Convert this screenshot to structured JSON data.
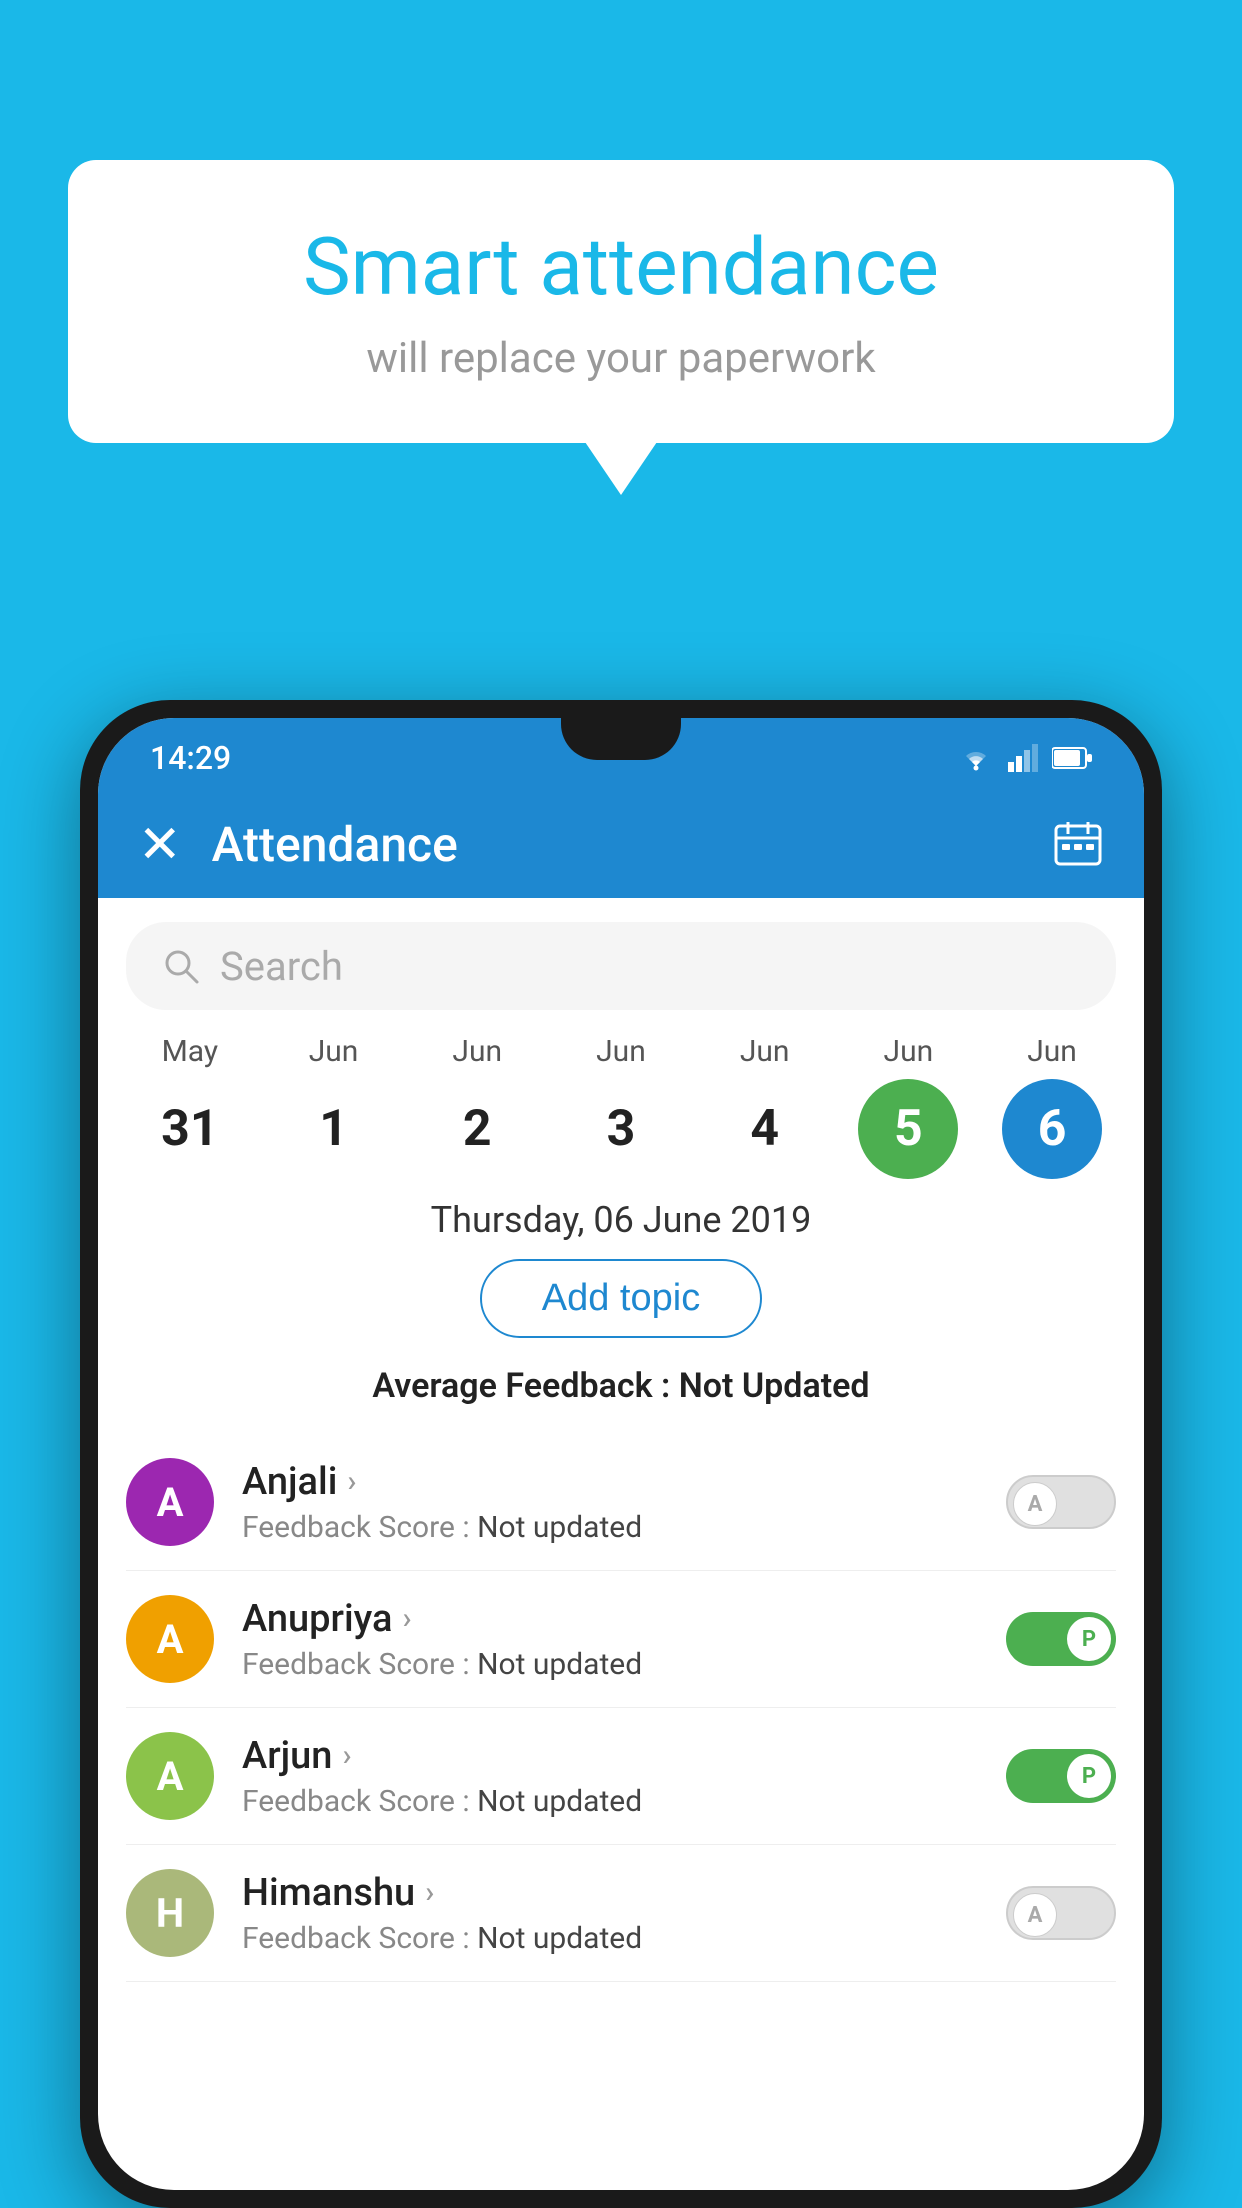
{
  "background_color": "#1ab8e8",
  "bubble": {
    "title": "Smart attendance",
    "subtitle": "will replace your paperwork"
  },
  "status_bar": {
    "time": "14:29"
  },
  "app_bar": {
    "title": "Attendance",
    "close_label": "×"
  },
  "search": {
    "placeholder": "Search"
  },
  "calendar": {
    "days": [
      {
        "month": "May",
        "date": "31",
        "state": "normal"
      },
      {
        "month": "Jun",
        "date": "1",
        "state": "normal"
      },
      {
        "month": "Jun",
        "date": "2",
        "state": "normal"
      },
      {
        "month": "Jun",
        "date": "3",
        "state": "normal"
      },
      {
        "month": "Jun",
        "date": "4",
        "state": "normal"
      },
      {
        "month": "Jun",
        "date": "5",
        "state": "today"
      },
      {
        "month": "Jun",
        "date": "6",
        "state": "selected"
      }
    ]
  },
  "selected_date": "Thursday, 06 June 2019",
  "add_topic_label": "Add topic",
  "avg_feedback_label": "Average Feedback :",
  "avg_feedback_value": "Not Updated",
  "students": [
    {
      "name": "Anjali",
      "avatar_letter": "A",
      "avatar_color": "#9c27b0",
      "feedback_label": "Feedback Score :",
      "feedback_value": "Not updated",
      "toggle": "off",
      "toggle_label": "A"
    },
    {
      "name": "Anupriya",
      "avatar_letter": "A",
      "avatar_color": "#f0a000",
      "feedback_label": "Feedback Score :",
      "feedback_value": "Not updated",
      "toggle": "on",
      "toggle_label": "P"
    },
    {
      "name": "Arjun",
      "avatar_letter": "A",
      "avatar_color": "#8bc34a",
      "feedback_label": "Feedback Score :",
      "feedback_value": "Not updated",
      "toggle": "on",
      "toggle_label": "P"
    },
    {
      "name": "Himanshu",
      "avatar_letter": "H",
      "avatar_color": "#aab87a",
      "feedback_label": "Feedback Score :",
      "feedback_value": "Not updated",
      "toggle": "off",
      "toggle_label": "A"
    }
  ]
}
